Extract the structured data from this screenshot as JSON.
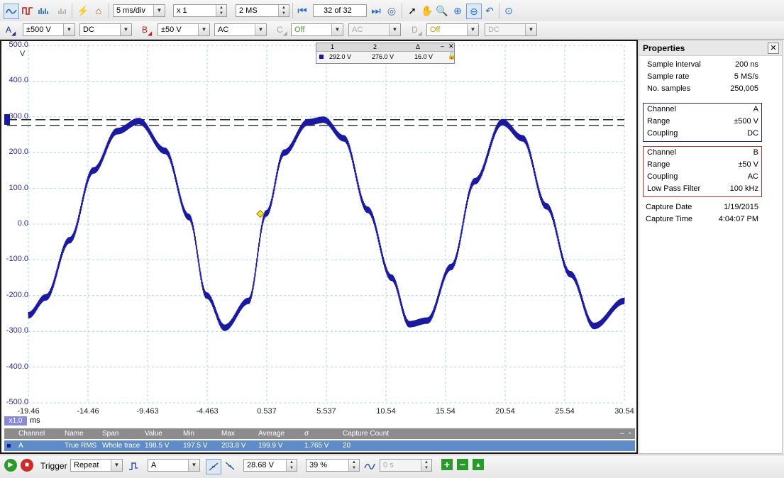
{
  "toolbar": {
    "timebase": "5 ms/div",
    "zoom": "x 1",
    "samples": "2 MS",
    "buffer_position": "32",
    "buffer_of": "of 32"
  },
  "channels": {
    "a_label": "A",
    "a_range": "±500 V",
    "a_coupling": "DC",
    "b_label": "B",
    "b_range": "±50 V",
    "b_coupling": "AC",
    "c_label": "C",
    "c_range": "Off",
    "c_coupling": "AC",
    "d_label": "D",
    "d_range": "Off",
    "d_coupling": "DC"
  },
  "scope": {
    "y_unit": "V",
    "y_ticks": [
      "500.0",
      "400.0",
      "300.0",
      "200.0",
      "100.0",
      "0.0",
      "-100.0",
      "-200.0",
      "-300.0",
      "-400.0",
      "-500.0"
    ],
    "x_ticks": [
      "-19.46",
      "-14.46",
      "-9.463",
      "-4.463",
      "0.537",
      "5.537",
      "10.54",
      "15.54",
      "20.54",
      "25.54",
      "30.54"
    ],
    "x_zoom": "x1.0",
    "x_unit": "ms",
    "ruler_values": [
      292.0,
      276.0
    ],
    "trigger_level": 28.68
  },
  "chart_data": {
    "type": "line",
    "series": [
      {
        "x": [
          -19.46,
          -18.0,
          -16.0,
          -14.0,
          -12.0,
          -10.2,
          -8.0,
          -6.0,
          -4.5,
          -3.0,
          -1.0,
          0.5,
          2.0,
          4.0,
          5.3,
          7.0,
          9.0,
          11.0,
          12.5,
          14.0,
          16.0,
          18.0,
          20.3,
          22.0,
          24.0,
          26.0,
          28.0,
          30.54
        ],
        "y": [
          -255,
          -205,
          -45,
          150,
          260,
          288,
          205,
          20,
          -200,
          -290,
          -215,
          30,
          200,
          285,
          292,
          240,
          40,
          -150,
          -280,
          -270,
          -120,
          120,
          285,
          240,
          50,
          -140,
          -285,
          -215
        ]
      }
    ],
    "xlim": [
      -19.46,
      30.54
    ],
    "ylim": [
      -500,
      500
    ],
    "grid": true
  },
  "cursor_table": {
    "col1": "1",
    "col2": "2",
    "col3": "Δ",
    "v1": "292.0 V",
    "v2": "276.0 V",
    "v3": "16.0 V"
  },
  "measurements": {
    "headers": [
      "Channel",
      "Name",
      "Span",
      "Value",
      "Min",
      "Max",
      "Average",
      "σ",
      "Capture Count"
    ],
    "row": [
      "A",
      "True RMS",
      "Whole trace",
      "198.5 V",
      "197.5 V",
      "203.8 V",
      "199.9 V",
      "1.765 V",
      "20"
    ]
  },
  "properties": {
    "title": "Properties",
    "general": [
      {
        "k": "Sample interval",
        "v": "200 ns"
      },
      {
        "k": "Sample rate",
        "v": "5 MS/s"
      },
      {
        "k": "No. samples",
        "v": "250,005"
      }
    ],
    "channel_a": [
      {
        "k": "Channel",
        "v": "A"
      },
      {
        "k": "Range",
        "v": "±500 V"
      },
      {
        "k": "Coupling",
        "v": "DC"
      }
    ],
    "channel_b": [
      {
        "k": "Channel",
        "v": "B"
      },
      {
        "k": "Range",
        "v": "±50 V"
      },
      {
        "k": "Coupling",
        "v": "AC"
      },
      {
        "k": "Low Pass Filter",
        "v": "100 kHz"
      }
    ],
    "capture": [
      {
        "k": "Capture Date",
        "v": "1/19/2015"
      },
      {
        "k": "Capture Time",
        "v": "4:04:07 PM"
      }
    ]
  },
  "bottom": {
    "trigger_label": "Trigger",
    "trigger_mode": "Repeat",
    "trigger_source": "A",
    "trigger_level": "28.68 V",
    "pretrigger": "39 %",
    "delay": "0 s"
  },
  "colors": {
    "trace": "#1a1aa0",
    "channel_a_border": "#1f2f7a",
    "channel_b_border": "#c03030",
    "measure_row": "#5f8cc8"
  }
}
